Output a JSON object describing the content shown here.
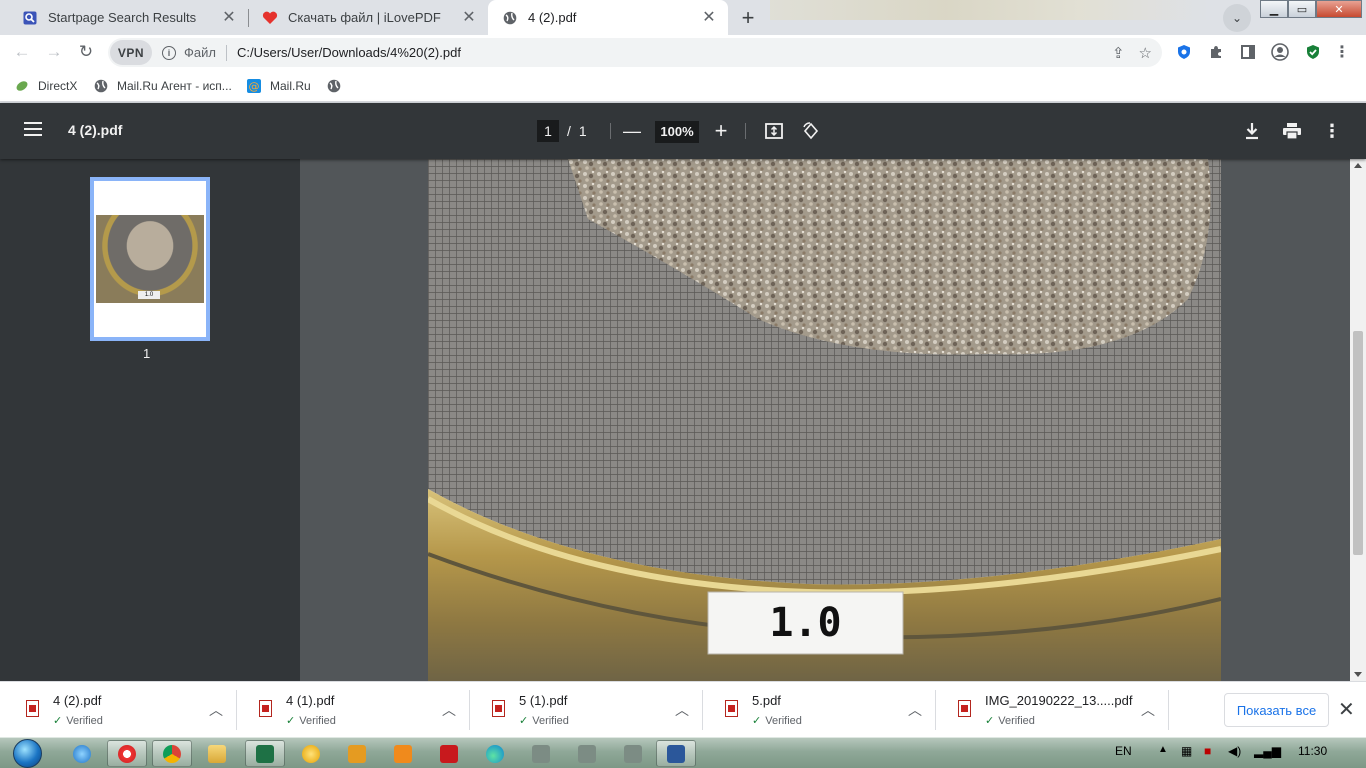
{
  "tabs": [
    {
      "title": "Startpage Search Results",
      "favicon": "startpage-icon",
      "active": false
    },
    {
      "title": "Скачать файл | iLovePDF",
      "favicon": "ilovepdf-heart-icon",
      "active": false
    },
    {
      "title": "4 (2).pdf",
      "favicon": "globe-icon",
      "active": true
    }
  ],
  "omnibox": {
    "vpn_label": "VPN",
    "scheme": "Файл",
    "url": "C:/Users/User/Downloads/4%20(2).pdf"
  },
  "bookmarks": [
    {
      "label": "DirectX"
    },
    {
      "label": "Mail.Ru Агент - исп..."
    },
    {
      "label": "Mail.Ru"
    },
    {
      "label": ""
    }
  ],
  "pdf": {
    "title": "4 (2).pdf",
    "current_page": "1",
    "page_sep": "/",
    "total_pages": "1",
    "zoom": "100%",
    "thumbnail_label": "1",
    "sieve_label": "1.0"
  },
  "downloads": [
    {
      "name": "4 (2).pdf",
      "status": "Verified"
    },
    {
      "name": "4 (1).pdf",
      "status": "Verified"
    },
    {
      "name": "5 (1).pdf",
      "status": "Verified"
    },
    {
      "name": "5.pdf",
      "status": "Verified"
    },
    {
      "name": "IMG_20190222_13.....pdf",
      "status": "Verified"
    }
  ],
  "download_shelf": {
    "show_all": "Показать все"
  },
  "taskbar": {
    "lang": "EN",
    "time": "11:30"
  },
  "colors": {
    "pdf_toolbar": "#323639",
    "pdf_viewer_bg": "#525659",
    "thumbnail_border": "#8ab4f8",
    "link_blue": "#1a73e8",
    "verified_green": "#188038"
  }
}
